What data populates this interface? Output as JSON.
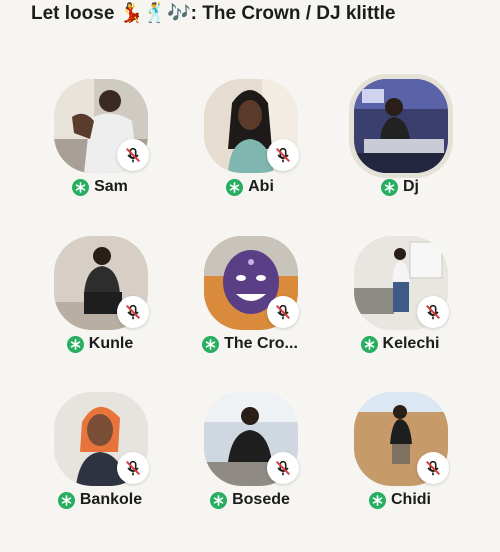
{
  "room": {
    "title": "Let loose 💃🕺🎶: The Crown / DJ klittle"
  },
  "speakers": [
    {
      "name": "Sam",
      "muted": true,
      "moderator": true,
      "speaking": false
    },
    {
      "name": "Abi",
      "muted": true,
      "moderator": true,
      "speaking": false
    },
    {
      "name": "Dj",
      "muted": false,
      "moderator": true,
      "speaking": true
    },
    {
      "name": "Kunle",
      "muted": true,
      "moderator": true,
      "speaking": false
    },
    {
      "name": "The Cro...",
      "muted": true,
      "moderator": true,
      "speaking": false
    },
    {
      "name": "Kelechi",
      "muted": true,
      "moderator": true,
      "speaking": false
    },
    {
      "name": "Bankole",
      "muted": true,
      "moderator": true,
      "speaking": false
    },
    {
      "name": "Bosede",
      "muted": true,
      "moderator": true,
      "speaking": false
    },
    {
      "name": "Chidi",
      "muted": true,
      "moderator": true,
      "speaking": false
    }
  ],
  "colors": {
    "background": "#f6f5f1",
    "moderator_badge": "#27ae60",
    "mute_icon": "#d63b3b",
    "active_ring": "#e5e1d6"
  }
}
